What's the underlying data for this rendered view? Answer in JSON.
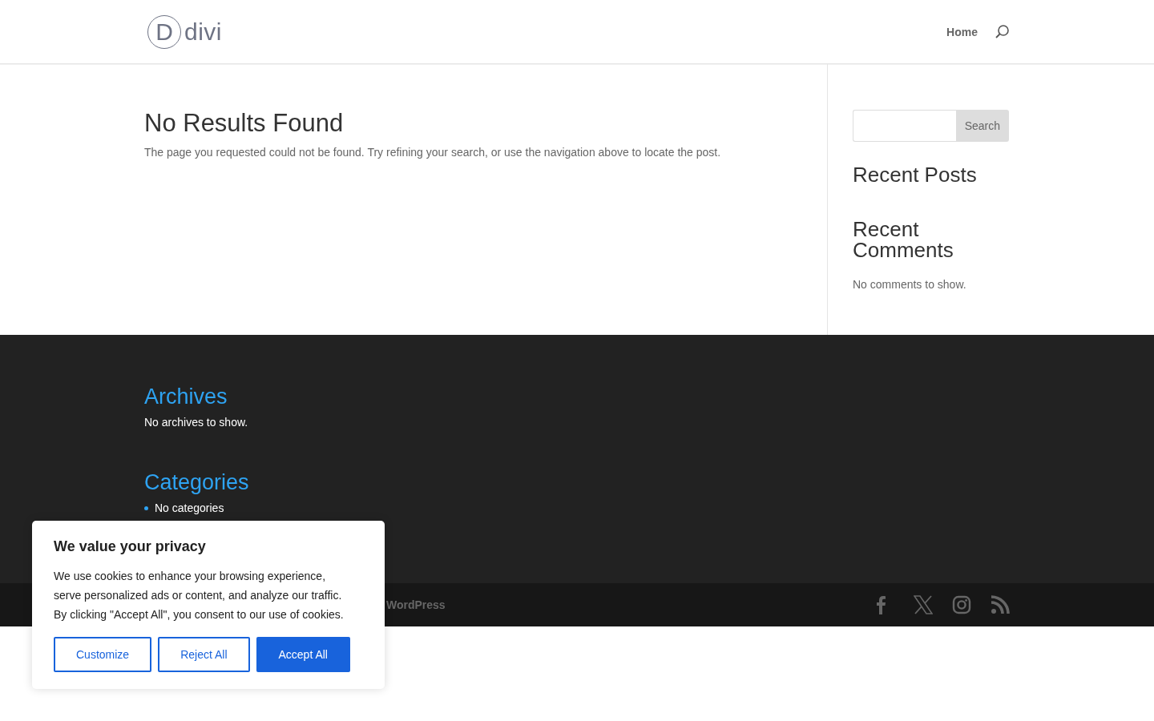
{
  "header": {
    "logo_text": "divi",
    "logo_letter": "D",
    "nav": [
      {
        "label": "Home"
      }
    ]
  },
  "main": {
    "title": "No Results Found",
    "message": "The page you requested could not be found. Try refining your search, or use the navigation above to locate the post."
  },
  "sidebar": {
    "search_button": "Search",
    "widgets": [
      {
        "title": "Recent Posts"
      },
      {
        "title": "Recent Comments",
        "text": "No comments to show."
      }
    ]
  },
  "footer": {
    "widgets": [
      {
        "title": "Archives",
        "kind": "text",
        "text": "No archives to show."
      },
      {
        "title": "Categories",
        "kind": "list",
        "items": [
          "No categories"
        ]
      }
    ],
    "credit": "WordPress",
    "social": [
      {
        "kind": "facebook"
      },
      {
        "kind": "x"
      },
      {
        "kind": "instagram"
      },
      {
        "kind": "rss"
      }
    ]
  },
  "cookie": {
    "title": "We value your privacy",
    "text": "We use cookies to enhance your browsing experience, serve personalized ads or content, and analyze our traffic. By clicking \"Accept All\", you consent to our use of cookies.",
    "buttons": [
      {
        "label": "Customize",
        "kind": "outline"
      },
      {
        "label": "Reject All",
        "kind": "outline"
      },
      {
        "label": "Accept All",
        "kind": "primary"
      }
    ]
  }
}
